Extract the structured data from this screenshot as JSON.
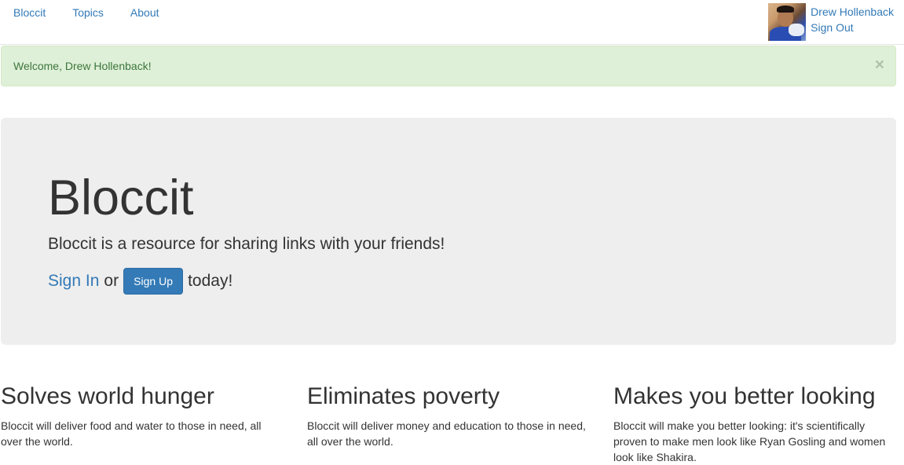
{
  "nav": {
    "brand": "Bloccit",
    "links": [
      "Topics",
      "About"
    ]
  },
  "user": {
    "name": "Drew Hollenback",
    "sign_out": "Sign Out"
  },
  "alert": {
    "message": "Welcome, Drew Hollenback!",
    "close": "×"
  },
  "jumbotron": {
    "title": "Bloccit",
    "lead": "Bloccit is a resource for sharing links with your friends!",
    "sign_in": "Sign In",
    "or": "or",
    "sign_up": "Sign Up",
    "today": "today!"
  },
  "features": [
    {
      "title": "Solves world hunger",
      "text": "Bloccit will deliver food and water to those in need, all over the world."
    },
    {
      "title": "Eliminates poverty",
      "text": "Bloccit will deliver money and education to those in need, all over the world."
    },
    {
      "title": "Makes you better looking",
      "text": "Bloccit will make you better looking: it's scientifically proven to make men look like Ryan Gosling and women look like Shakira."
    }
  ],
  "colors": {
    "link": "#337ab7",
    "alert_bg": "#dff0d8",
    "alert_text": "#3c763d",
    "jumbotron_bg": "#eeeeee",
    "primary_button": "#337ab7"
  }
}
